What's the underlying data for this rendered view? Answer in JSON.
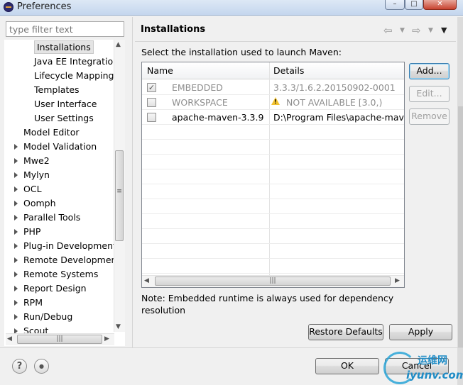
{
  "window": {
    "title": "Preferences",
    "controls": [
      "–",
      "□",
      "✕"
    ]
  },
  "filter": {
    "placeholder": "type filter text"
  },
  "tree": {
    "items": [
      {
        "label": "Installations",
        "level": 2,
        "expandable": false,
        "selected": true
      },
      {
        "label": "Java EE Integratio",
        "level": 2,
        "expandable": false
      },
      {
        "label": "Lifecycle Mapping",
        "level": 2,
        "expandable": false
      },
      {
        "label": "Templates",
        "level": 2,
        "expandable": false
      },
      {
        "label": "User Interface",
        "level": 2,
        "expandable": false
      },
      {
        "label": "User Settings",
        "level": 2,
        "expandable": false
      },
      {
        "label": "Model Editor",
        "level": 1,
        "expandable": false
      },
      {
        "label": "Model Validation",
        "level": 1,
        "expandable": true
      },
      {
        "label": "Mwe2",
        "level": 1,
        "expandable": true
      },
      {
        "label": "Mylyn",
        "level": 1,
        "expandable": true
      },
      {
        "label": "OCL",
        "level": 1,
        "expandable": true
      },
      {
        "label": "Oomph",
        "level": 1,
        "expandable": true
      },
      {
        "label": "Parallel Tools",
        "level": 1,
        "expandable": true
      },
      {
        "label": "PHP",
        "level": 1,
        "expandable": true
      },
      {
        "label": "Plug-in Development",
        "level": 1,
        "expandable": true
      },
      {
        "label": "Remote Development",
        "level": 1,
        "expandable": true
      },
      {
        "label": "Remote Systems",
        "level": 1,
        "expandable": true
      },
      {
        "label": "Report Design",
        "level": 1,
        "expandable": true
      },
      {
        "label": "RPM",
        "level": 1,
        "expandable": true
      },
      {
        "label": "Run/Debug",
        "level": 1,
        "expandable": true
      },
      {
        "label": "Scout",
        "level": 1,
        "expandable": true
      }
    ]
  },
  "page": {
    "title": "Installations",
    "instruction": "Select the installation used to launch Maven:",
    "table": {
      "columns": [
        "Name",
        "Details"
      ],
      "rows": [
        {
          "name": "EMBEDDED",
          "details": "3.3.3/1.6.2.20150902-0001",
          "checked": true,
          "dimmed": true,
          "warning": false
        },
        {
          "name": "WORKSPACE",
          "details": "NOT AVAILABLE [3.0,)",
          "checked": false,
          "dimmed": true,
          "warning": true
        },
        {
          "name": "apache-maven-3.3.9",
          "details": "D:\\Program Files\\apache-maven",
          "checked": false,
          "dimmed": false,
          "warning": false
        }
      ]
    },
    "buttons": {
      "add": "Add...",
      "edit": "Edit...",
      "remove": "Remove"
    },
    "note": "Note: Embedded runtime is always used for dependency resolution",
    "restore_defaults": "Restore Defaults",
    "apply": "Apply"
  },
  "footer": {
    "help_icon": "?",
    "ok": "OK",
    "cancel": "Cancel"
  },
  "watermark": {
    "line1": "运维网",
    "line2": "iyunv.com"
  }
}
